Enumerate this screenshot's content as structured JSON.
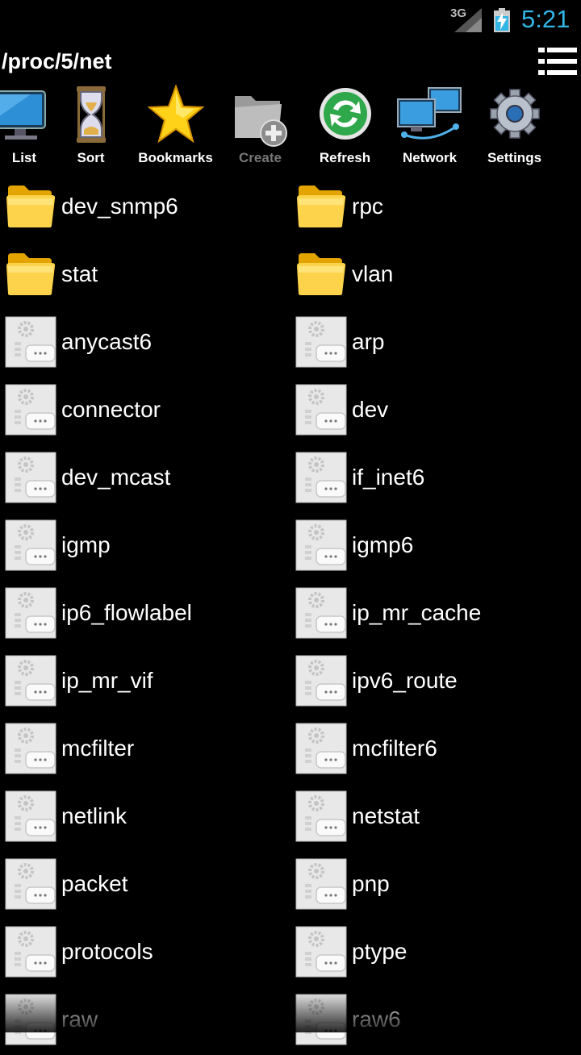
{
  "status_bar": {
    "network": "3G",
    "time": "5:21"
  },
  "header": {
    "path": "/proc/5/net",
    "menu_icon": "list-menu-icon"
  },
  "toolbar": [
    {
      "label": "List",
      "icon": "monitor-icon",
      "enabled": true
    },
    {
      "label": "Sort",
      "icon": "hourglass-icon",
      "enabled": true
    },
    {
      "label": "Bookmarks",
      "icon": "star-icon",
      "enabled": true
    },
    {
      "label": "Create",
      "icon": "new-folder-icon",
      "enabled": false
    },
    {
      "label": "Refresh",
      "icon": "refresh-icon",
      "enabled": true
    },
    {
      "label": "Network",
      "icon": "network-icon",
      "enabled": true
    },
    {
      "label": "Settings",
      "icon": "gear-icon",
      "enabled": true
    }
  ],
  "files": [
    {
      "name": "dev_snmp6",
      "type": "folder"
    },
    {
      "name": "rpc",
      "type": "folder"
    },
    {
      "name": "stat",
      "type": "folder"
    },
    {
      "name": "vlan",
      "type": "folder"
    },
    {
      "name": "anycast6",
      "type": "file"
    },
    {
      "name": "arp",
      "type": "file"
    },
    {
      "name": "connector",
      "type": "file"
    },
    {
      "name": "dev",
      "type": "file"
    },
    {
      "name": "dev_mcast",
      "type": "file"
    },
    {
      "name": "if_inet6",
      "type": "file"
    },
    {
      "name": "igmp",
      "type": "file"
    },
    {
      "name": "igmp6",
      "type": "file"
    },
    {
      "name": "ip6_flowlabel",
      "type": "file"
    },
    {
      "name": "ip_mr_cache",
      "type": "file"
    },
    {
      "name": "ip_mr_vif",
      "type": "file"
    },
    {
      "name": "ipv6_route",
      "type": "file"
    },
    {
      "name": "mcfilter",
      "type": "file"
    },
    {
      "name": "mcfilter6",
      "type": "file"
    },
    {
      "name": "netlink",
      "type": "file"
    },
    {
      "name": "netstat",
      "type": "file"
    },
    {
      "name": "packet",
      "type": "file"
    },
    {
      "name": "pnp",
      "type": "file"
    },
    {
      "name": "protocols",
      "type": "file"
    },
    {
      "name": "ptype",
      "type": "file"
    },
    {
      "name": "raw",
      "type": "file"
    },
    {
      "name": "raw6",
      "type": "file"
    }
  ],
  "colors": {
    "clock": "#33b5e5",
    "folder": "#f5c01a",
    "background": "#000000"
  }
}
